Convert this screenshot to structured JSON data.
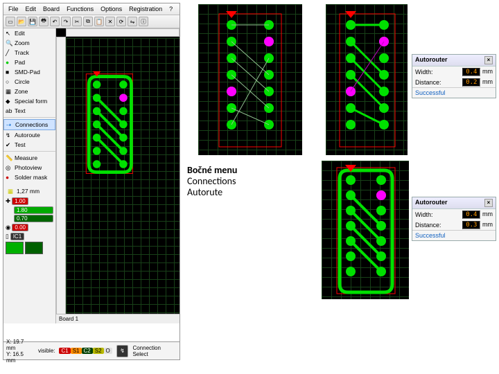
{
  "menubar": [
    "File",
    "Edit",
    "Board",
    "Functions",
    "Options",
    "Registration",
    "?"
  ],
  "sidebar": {
    "items": [
      {
        "label": "Edit",
        "icon": "cursor"
      },
      {
        "label": "Zoom",
        "icon": "zoom"
      },
      {
        "label": "Track",
        "icon": "track"
      },
      {
        "label": "Pad",
        "icon": "pad"
      },
      {
        "label": "SMD-Pad",
        "icon": "smd"
      },
      {
        "label": "Circle",
        "icon": "circle"
      },
      {
        "label": "Zone",
        "icon": "zone"
      },
      {
        "label": "Special form",
        "icon": "special"
      },
      {
        "label": "Text",
        "icon": "text"
      }
    ],
    "items2": [
      {
        "label": "Connections",
        "icon": "conn",
        "selected": true
      },
      {
        "label": "Autoroute",
        "icon": "auto"
      },
      {
        "label": "Test",
        "icon": "test"
      },
      {
        "label": "Measure",
        "icon": "measure"
      },
      {
        "label": "Photoview",
        "icon": "photo"
      },
      {
        "label": "Solder mask",
        "icon": "mask"
      }
    ],
    "grid_value": "1,27 mm",
    "readouts": [
      "1.00",
      "1.80",
      "0.70",
      "0.00",
      "IC1"
    ]
  },
  "tab": "Board 1",
  "status": {
    "x": "X: 19.7 mm",
    "y": "Y: 16.5 mm",
    "visible_label": "visible:",
    "chips": [
      {
        "t": "C1",
        "bg": "#c00",
        "fg": "#fff"
      },
      {
        "t": "S1",
        "bg": "#ff8c00",
        "fg": "#000"
      },
      {
        "t": "C2",
        "bg": "#004000",
        "fg": "#fff"
      },
      {
        "t": "S2",
        "bg": "#b8b800",
        "fg": "#000"
      },
      {
        "t": "O",
        "bg": "#e0e0e0",
        "fg": "#000"
      }
    ],
    "right": "Connection Select"
  },
  "dialog1": {
    "title": "Autorouter",
    "rows": [
      {
        "label": "Width:",
        "value": "0.4",
        "unit": "mm"
      },
      {
        "label": "Distance:",
        "value": "0.2",
        "unit": "mm"
      }
    ],
    "message": "Successful"
  },
  "dialog2": {
    "title": "Autorouter",
    "rows": [
      {
        "label": "Width:",
        "value": "0.4",
        "unit": "mm"
      },
      {
        "label": "Distance:",
        "value": "0.3",
        "unit": "mm"
      }
    ],
    "message": "Successful"
  },
  "annotation": {
    "line1": "Bočné menu",
    "line2": "Connections",
    "line3": "Autorute"
  }
}
